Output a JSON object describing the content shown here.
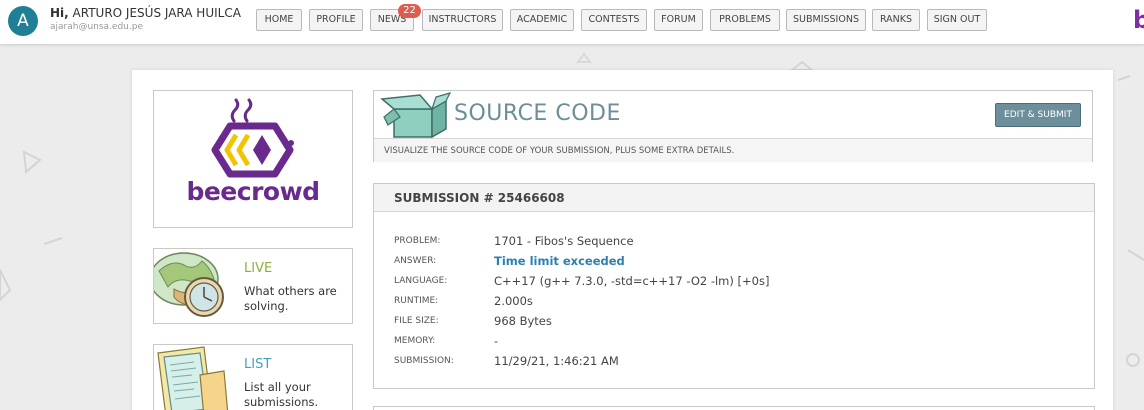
{
  "user": {
    "avatar_letter": "A",
    "greeting": "Hi,",
    "name": "ARTURO JESÚS JARA HUILCA",
    "email": "ajarah@unsa.edu.pe"
  },
  "nav": {
    "items": [
      {
        "label": "HOME"
      },
      {
        "label": "PROFILE"
      },
      {
        "label": "NEWS"
      },
      {
        "label": "INSTRUCTORS"
      },
      {
        "label": "ACADEMIC"
      },
      {
        "label": "CONTESTS"
      },
      {
        "label": "FORUM"
      },
      {
        "label": "PROBLEMS"
      },
      {
        "label": "SUBMISSIONS"
      },
      {
        "label": "RANKS"
      },
      {
        "label": "SIGN OUT"
      }
    ],
    "news_badge": "22",
    "brand_letter": "b"
  },
  "logo": {
    "text": "beecrowd"
  },
  "sidebar": {
    "live": {
      "title": "LIVE",
      "description": "What others are solving.",
      "icon": "globe-clock-icon"
    },
    "list": {
      "title": "LIST",
      "description": "List all your submissions.",
      "icon": "papers-icon"
    }
  },
  "source": {
    "title": "SOURCE CODE",
    "edit_button": "EDIT & SUBMIT",
    "subtitle": "VISUALIZE THE SOURCE CODE OF YOUR SUBMISSION, PLUS SOME EXTRA DETAILS.",
    "icon": "open-box-icon"
  },
  "submission": {
    "header": "SUBMISSION # 25466608",
    "rows": [
      {
        "label": "PROBLEM:",
        "value": "1701 - Fibos's Sequence"
      },
      {
        "label": "ANSWER:",
        "value": "Time limit exceeded"
      },
      {
        "label": "LANGUAGE:",
        "value": "C++17 (g++ 7.3.0, -std=c++17 -O2 -lm) [+0s]"
      },
      {
        "label": "RUNTIME:",
        "value": "2.000s"
      },
      {
        "label": "FILE SIZE:",
        "value": "968 Bytes"
      },
      {
        "label": "MEMORY:",
        "value": "-"
      },
      {
        "label": "SUBMISSION:",
        "value": "11/29/21, 1:46:21 AM"
      }
    ]
  },
  "colors": {
    "accent": "#6d8f9c",
    "brand": "#6a2a8d",
    "logo_yellow": "#f3c300",
    "answer": "#2d7fb0",
    "live": "#8ab23a",
    "list": "#3fa0c5"
  }
}
